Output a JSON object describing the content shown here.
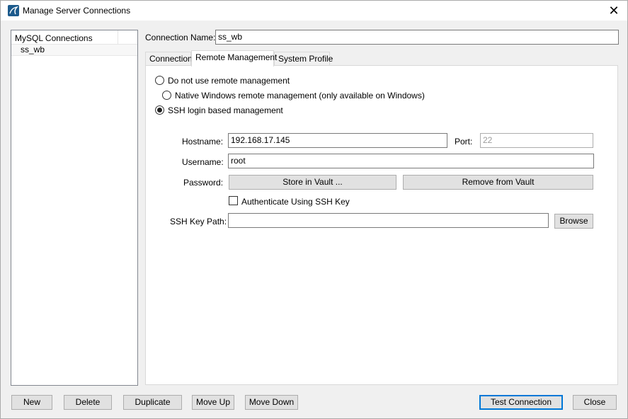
{
  "window": {
    "title": "Manage Server Connections",
    "close_glyph": "✕"
  },
  "sidebar": {
    "header": "MySQL Connections",
    "items": [
      {
        "label": "ss_wb"
      }
    ]
  },
  "connection_name": {
    "label": "Connection Name:",
    "value": "ss_wb"
  },
  "tabs": [
    {
      "label": "Connection"
    },
    {
      "label": "Remote Management",
      "active": true
    },
    {
      "label": "System Profile"
    }
  ],
  "remote": {
    "options": [
      {
        "label": "Do not use remote management",
        "checked": false
      },
      {
        "label": "Native Windows remote management (only available on Windows)",
        "checked": false
      },
      {
        "label": "SSH login based management",
        "checked": true
      }
    ],
    "hostname": {
      "label": "Hostname:",
      "value": "192.168.17.145"
    },
    "port": {
      "label": "Port:",
      "value": "22"
    },
    "username": {
      "label": "Username:",
      "value": "root"
    },
    "password": {
      "label": "Password:",
      "store_button": "Store in Vault ...",
      "remove_button": "Remove from Vault"
    },
    "ssh_key_checkbox": {
      "label": "Authenticate Using SSH Key",
      "checked": false
    },
    "ssh_key_path": {
      "label": "SSH Key Path:",
      "value": "",
      "browse_button": "Browse"
    }
  },
  "footer": {
    "new": "New",
    "delete": "Delete",
    "duplicate": "Duplicate",
    "move_up": "Move Up",
    "move_down": "Move Down",
    "test_connection": "Test Connection",
    "close": "Close"
  },
  "colors": {
    "accent": "#0078d7",
    "app_icon": "#1c5a8c"
  },
  "icons": {
    "app": "mysql-workbench-icon",
    "close": "close-icon"
  }
}
